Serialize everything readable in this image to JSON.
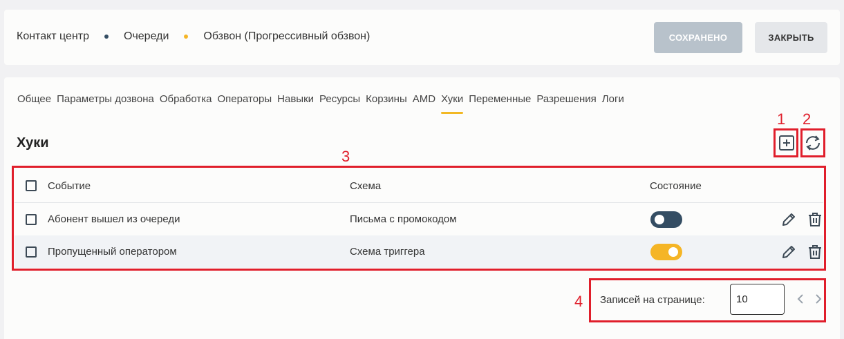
{
  "breadcrumb": {
    "items": [
      "Контакт центр",
      "Очереди",
      "Обзвон (Прогрессивный обзвон)"
    ],
    "dot_colors": [
      "#344d63",
      "#f5b526"
    ]
  },
  "header_buttons": {
    "saved": "СОХРАНЕНО",
    "close": "ЗАКРЫТЬ"
  },
  "tabs": [
    {
      "label": "Общее",
      "active": false
    },
    {
      "label": "Параметры дозвона",
      "active": false
    },
    {
      "label": "Обработка",
      "active": false
    },
    {
      "label": "Операторы",
      "active": false
    },
    {
      "label": "Навыки",
      "active": false
    },
    {
      "label": "Ресурсы",
      "active": false
    },
    {
      "label": "Корзины",
      "active": false
    },
    {
      "label": "AMD",
      "active": false
    },
    {
      "label": "Хуки",
      "active": true
    },
    {
      "label": "Переменные",
      "active": false
    },
    {
      "label": "Разрешения",
      "active": false
    },
    {
      "label": "Логи",
      "active": false
    }
  ],
  "section": {
    "title": "Хуки"
  },
  "toolbar": {
    "add_icon": "plus-square-icon",
    "refresh_icon": "refresh-icon"
  },
  "table": {
    "columns": [
      "Событие",
      "Схема",
      "Состояние"
    ],
    "rows": [
      {
        "event": "Абонент вышел из очереди",
        "scheme": "Письма с промокодом",
        "enabled": false
      },
      {
        "event": "Пропущенный оператором",
        "scheme": "Схема триггера",
        "enabled": true
      }
    ]
  },
  "pagination": {
    "label": "Записей на странице:",
    "per_page": "10"
  },
  "annotations": [
    "1",
    "2",
    "3",
    "4"
  ],
  "colors": {
    "accent": "#f5b526",
    "toggle_off": "#344d63",
    "annotation": "#e01e2b"
  }
}
